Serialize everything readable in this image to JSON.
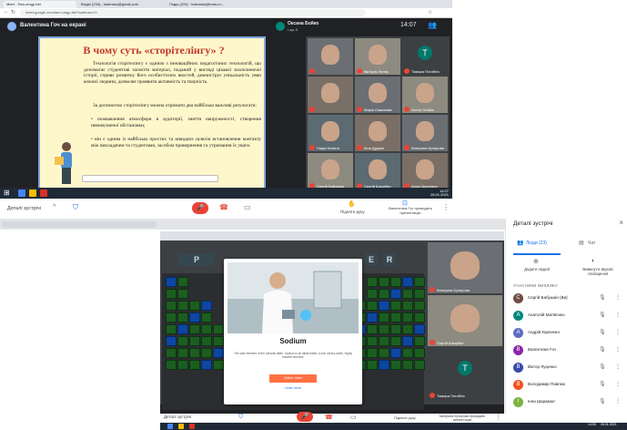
{
  "top_window": {
    "tabs": [
      "Meet - Tam-zmgp-bkt",
      "Вхідні (234) - kalenska@gmail.com",
      "Подія (224) · kalenska@man-m...",
      "Google Meet"
    ],
    "url": "meet.google.com/tam-zmgp-bkt?authuser=0",
    "presenter_label": "Валентина Гоч на екрані",
    "self_name": "Оксана Бойко",
    "self_sub": "і ще 8",
    "time": "14:07",
    "slide": {
      "title": "В чому суть «сторітелінгу» ?",
      "para1": "Технологія сторітелінгу є однією з інноваційних педагогічних технологій, що допомагає студентові засвоїти матеріал, поданий у вигляді цікавої захоплюючої історії, сприяє розвитку його особистісних якостей, демонструє унікальність уяви кожної людини, дозволяє проявити активність та творчість.",
      "para2": "За допомогою сторітелінгу можна отримати два найбільш важливі результати:",
      "bullet1": "пожвавлення атмосфери в аудиторії, зняття напруженості, створення невимушеної обстановки;",
      "bullet2": "він є одним із найбільш простих та швидких шляхів встановлення контакту між викладачем та студентами, засобом привернення та утримання їх уваги."
    },
    "tiles": [
      {
        "name": "",
        "kind": "video"
      },
      {
        "name": "Вікторія Лютик",
        "kind": "video"
      },
      {
        "name": "Тамара Погибна",
        "kind": "avatar",
        "letter": "Т",
        "color": "#00796b"
      },
      {
        "name": "",
        "kind": "video"
      },
      {
        "name": "Марія Ложинова",
        "kind": "video"
      },
      {
        "name": "Антон Олаїко",
        "kind": "video"
      },
      {
        "name": "Надія Кочина",
        "kind": "video"
      },
      {
        "name": "Інна Дудник",
        "kind": "video"
      },
      {
        "name": "Катерина Кучерова",
        "kind": "video"
      },
      {
        "name": "Сергій Бабушкін",
        "kind": "video"
      },
      {
        "name": "Сергій Шкарбан",
        "kind": "video"
      },
      {
        "name": "Анна Шаргевич",
        "kind": "video"
      }
    ],
    "taskbar_time": "14:07",
    "taskbar_date": "26.01.2021"
  },
  "controls_top": {
    "details": "Деталі зустрічі",
    "raise_hand": "Підняти руку",
    "present": "Валентина Гоч проводить презентацію"
  },
  "bottom_window": {
    "modal": {
      "title": "Sodium",
      "body": "The sixth element of the periodic table. Sodium is an alkali metal, a soft, silvery-white, highly reactive element.",
      "button": "Watch video",
      "link": "Learn more"
    },
    "ptable_letters": [
      "P",
      "E",
      "R"
    ],
    "side_panel": {
      "title": "Деталі зустрічі",
      "tab_people": "Люди (23)",
      "tab_chat": "Чат",
      "add_people": "Додати людей",
      "recording": "Вимкнути звукові сповіщення",
      "section": "УЧАСНИКИ ВИКЛИКУ",
      "people": [
        {
          "name": "Сергій Бабушкін (Ви)",
          "letter": "С",
          "color": "#6d4c41"
        },
        {
          "name": "Анатолій Матвієнко",
          "letter": "А",
          "color": "#00897b"
        },
        {
          "name": "Андрій Карпенко",
          "letter": "А",
          "color": "#5c6bc0"
        },
        {
          "name": "Валентина Гоч",
          "letter": "В",
          "color": "#8e24aa"
        },
        {
          "name": "Віктор Луценко",
          "letter": "В",
          "color": "#3949ab"
        },
        {
          "name": "Володимир Павлюк",
          "letter": "В",
          "color": "#f4511e"
        },
        {
          "name": "Інна Шарамют",
          "letter": "І",
          "color": "#7cb342"
        }
      ]
    },
    "tiles2": [
      {
        "name": "Катерина Кучерова",
        "kind": "video"
      },
      {
        "name": "Сергій Шкарбан",
        "kind": "video"
      },
      {
        "name": "Тамара Погибна",
        "kind": "avatar",
        "letter": "T",
        "color": "#00796b"
      }
    ],
    "controls": {
      "details": "Деталі зустрічі",
      "raise_hand": "Підняти руку",
      "present": "Катерина Кучерова проводить презентацію"
    },
    "taskbar_time": "14:09",
    "taskbar_date": "26.01.2021"
  }
}
